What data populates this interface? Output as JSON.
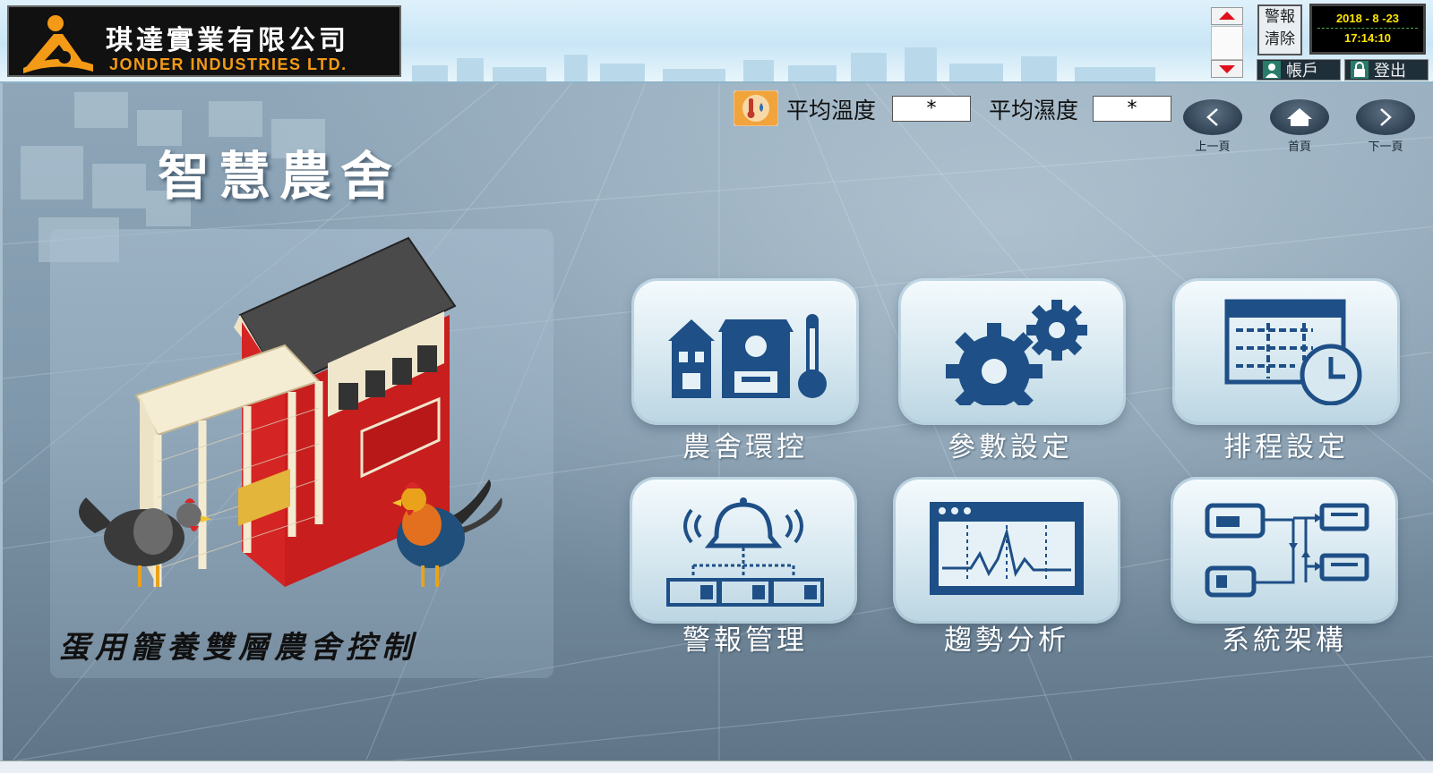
{
  "header": {
    "company_name_cn": "琪達實業有限公司",
    "company_name_en": "JONDER INDUSTRIES LTD.",
    "alarm_clear_label_1": "警報",
    "alarm_clear_label_2": "清除",
    "date": "2018 - 8 -23",
    "time": "17:14:10",
    "account_label": "帳戶",
    "logout_label": "登出"
  },
  "page": {
    "title": "智慧農舍",
    "coop_caption": "蛋用籠養雙層農舍控制"
  },
  "metrics": {
    "avg_temp_label": "平均溫度",
    "avg_temp_value": "*",
    "avg_humidity_label": "平均濕度",
    "avg_humidity_value": "*"
  },
  "nav": {
    "prev_label": "上一頁",
    "home_label": "首頁",
    "next_label": "下一頁"
  },
  "tiles": [
    {
      "label": "農舍環控",
      "icon": "barn-thermometer-icon"
    },
    {
      "label": "參數設定",
      "icon": "gears-icon"
    },
    {
      "label": "排程設定",
      "icon": "schedule-clock-icon"
    },
    {
      "label": "警報管理",
      "icon": "alarm-bell-icon"
    },
    {
      "label": "趨勢分析",
      "icon": "trend-chart-icon"
    },
    {
      "label": "系統架構",
      "icon": "system-architecture-icon"
    }
  ],
  "colors": {
    "accent_blue": "#1e4f86",
    "brand_orange": "#f39a16",
    "clock_yellow": "#ffe600"
  }
}
